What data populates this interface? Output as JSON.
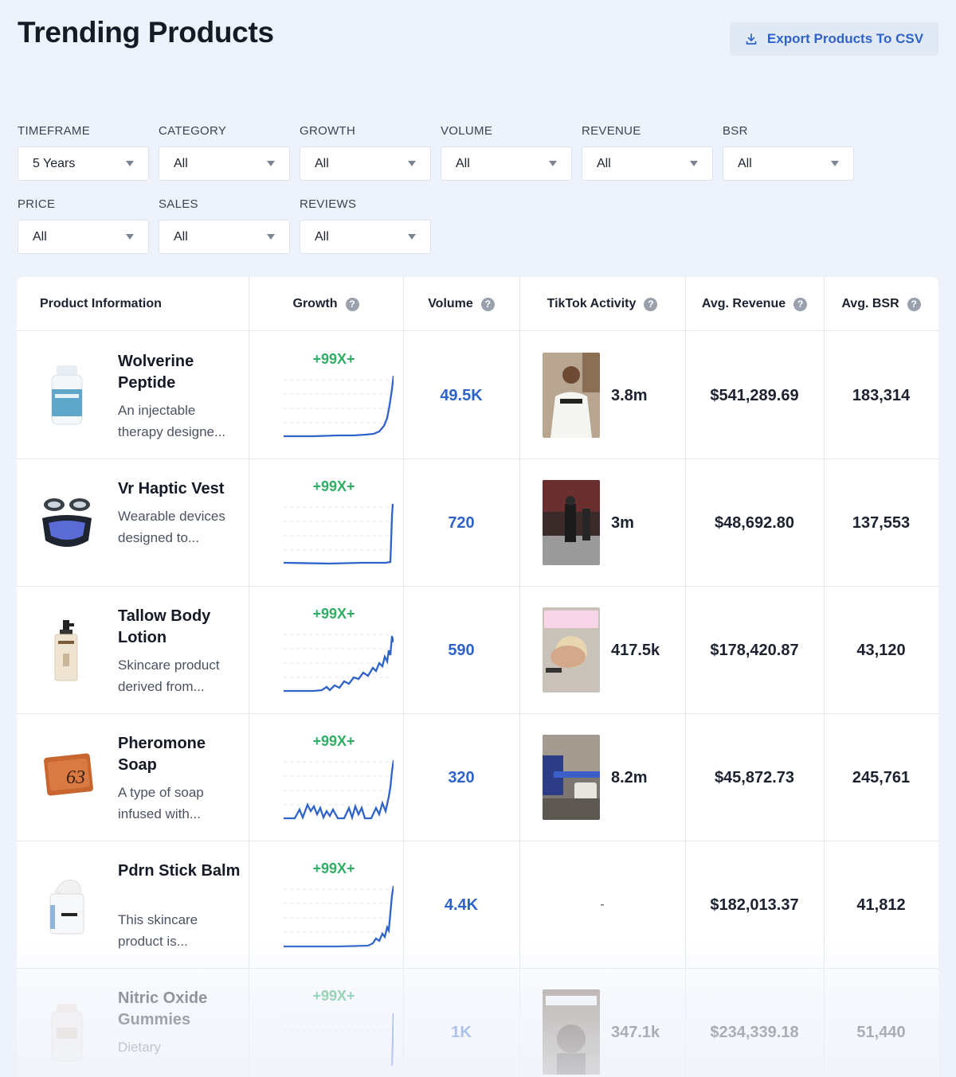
{
  "page": {
    "title": "Trending Products",
    "export_label": "Export Products To CSV"
  },
  "filters": [
    {
      "label": "TIMEFRAME",
      "value": "5 Years"
    },
    {
      "label": "CATEGORY",
      "value": "All"
    },
    {
      "label": "GROWTH",
      "value": "All"
    },
    {
      "label": "VOLUME",
      "value": "All"
    },
    {
      "label": "REVENUE",
      "value": "All"
    },
    {
      "label": "BSR",
      "value": "All"
    },
    {
      "label": "PRICE",
      "value": "All"
    },
    {
      "label": "SALES",
      "value": "All"
    },
    {
      "label": "REVIEWS",
      "value": "All"
    }
  ],
  "table": {
    "headers": {
      "product": "Product Information",
      "growth": "Growth",
      "volume": "Volume",
      "tiktok": "TikTok Activity",
      "revenue": "Avg. Revenue",
      "bsr": "Avg. BSR"
    },
    "help_glyph": "?",
    "rows": [
      {
        "name": "Wolverine Peptide",
        "description": "An injectable therapy designe...",
        "growth": "+99X+",
        "volume": "49.5K",
        "tiktok": "3.8m",
        "revenue": "$541,289.69",
        "bsr": "183,314"
      },
      {
        "name": "Vr Haptic Vest",
        "description": "Wearable devices designed to...",
        "growth": "+99X+",
        "volume": "720",
        "tiktok": "3m",
        "revenue": "$48,692.80",
        "bsr": "137,553"
      },
      {
        "name": "Tallow Body Lotion",
        "description": "Skincare product derived from...",
        "growth": "+99X+",
        "volume": "590",
        "tiktok": "417.5k",
        "revenue": "$178,420.87",
        "bsr": "43,120"
      },
      {
        "name": "Pheromone Soap",
        "description": "A type of soap infused with...",
        "growth": "+99X+",
        "volume": "320",
        "tiktok": "8.2m",
        "revenue": "$45,872.73",
        "bsr": "245,761"
      },
      {
        "name": "Pdrn Stick Balm",
        "description": "This skincare product is...",
        "growth": "+99X+",
        "volume": "4.4K",
        "tiktok": "-",
        "revenue": "$182,013.37",
        "bsr": "41,812"
      },
      {
        "name": "Nitric Oxide Gummies",
        "description": "Dietary",
        "growth": "+99X+",
        "volume": "1K",
        "tiktok": "347.1k",
        "revenue": "$234,339.18",
        "bsr": "51,440"
      }
    ]
  },
  "colors": {
    "accent": "#2f63c9",
    "growth": "#2fae63",
    "background": "#eef3fb"
  }
}
